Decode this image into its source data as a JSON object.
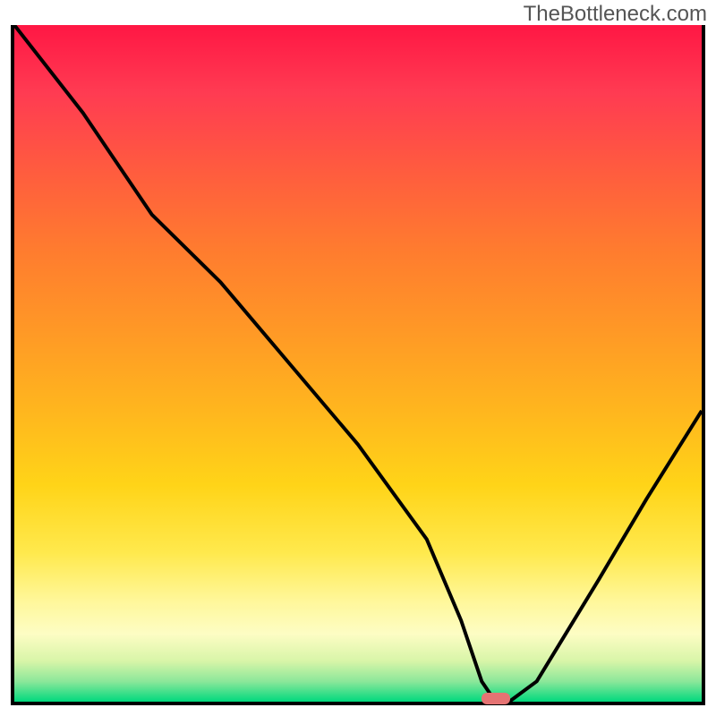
{
  "watermark": "TheBottleneck.com",
  "chart_data": {
    "type": "line",
    "title": "",
    "xlabel": "",
    "ylabel": "",
    "ylim": [
      0,
      100
    ],
    "xlim": [
      0,
      100
    ],
    "x": [
      0,
      10,
      20,
      30,
      40,
      50,
      60,
      65,
      68,
      70,
      72,
      76,
      85,
      92,
      100
    ],
    "values": [
      100,
      87,
      72,
      62,
      50,
      38,
      24,
      12,
      3,
      0,
      0,
      3,
      18,
      30,
      43
    ],
    "minimum_marker": {
      "x": 70,
      "y": 0
    },
    "colors": {
      "gradient_top": "#ff1744",
      "gradient_mid": "#ffd418",
      "gradient_bottom": "#00d97e",
      "frame": "#000000",
      "marker": "#e57373"
    }
  }
}
